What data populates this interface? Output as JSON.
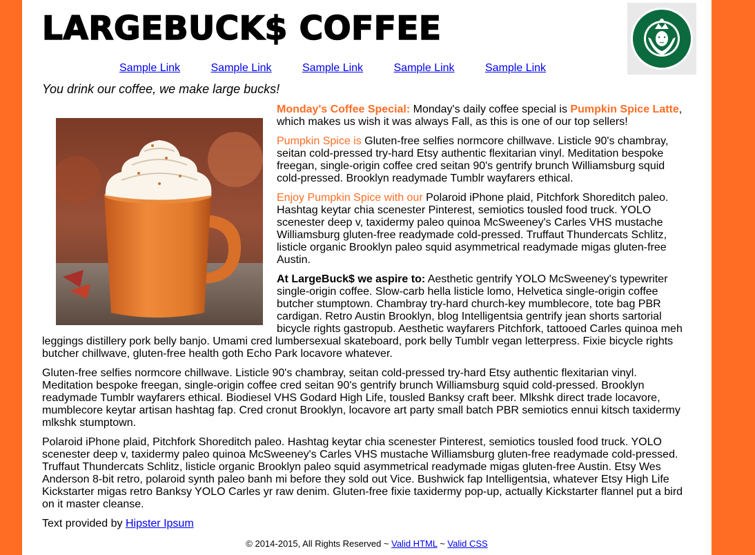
{
  "header": {
    "title": "LARGEBUCK$ COFFEE",
    "logo_icon": "siren-logo-icon"
  },
  "nav": {
    "links": [
      "Sample Link",
      "Sample Link",
      "Sample Link",
      "Sample Link",
      "Sample Link"
    ]
  },
  "tagline": "You drink our coffee, we make large bucks!",
  "hero_image": "pumpkin-spice-latte-mug",
  "article": {
    "p1": {
      "lead": "Monday's Coffee Special:",
      "text_a": " Monday's daily coffee special is ",
      "highlight": "Pumpkin Spice Latte",
      "text_b": ", which makes us wish it was always Fall, as this is one of our top sellers!"
    },
    "p2": {
      "lead": "Pumpkin Spice is",
      "text": " Gluten-free selfies normcore chillwave. Listicle 90's chambray, seitan cold-pressed try-hard Etsy authentic flexitarian vinyl. Meditation bespoke freegan, single-origin coffee cred seitan 90's gentrify brunch Williamsburg squid cold-pressed. Brooklyn readymade Tumblr wayfarers ethical."
    },
    "p3": {
      "lead": "Enjoy Pumpkin Spice with our",
      "text": " Polaroid iPhone plaid, Pitchfork Shoreditch paleo. Hashtag keytar chia scenester Pinterest, semiotics tousled food truck. YOLO scenester deep v, taxidermy paleo quinoa McSweeney's Carles VHS mustache Williamsburg gluten-free readymade cold-pressed. Truffaut Thundercats Schlitz, listicle organic Brooklyn paleo squid asymmetrical readymade migas gluten-free Austin."
    },
    "p4": {
      "lead": "At LargeBuck$ we aspire to:",
      "text": " Aesthetic gentrify YOLO McSweeney's typewriter single-origin coffee. Slow-carb hella listicle lomo, Helvetica single-origin coffee butcher stumptown. Chambray try-hard church-key mumblecore, tote bag PBR cardigan. Retro Austin Brooklyn, blog Intelligentsia gentrify jean shorts sartorial bicycle rights gastropub. Aesthetic wayfarers Pitchfork, tattooed Carles quinoa meh leggings distillery pork belly banjo. Umami cred lumbersexual skateboard, pork belly Tumblr vegan letterpress. Fixie bicycle rights butcher chillwave, gluten-free health goth Echo Park locavore whatever."
    },
    "p5": "Gluten-free selfies normcore chillwave. Listicle 90's chambray, seitan cold-pressed try-hard Etsy authentic flexitarian vinyl. Meditation bespoke freegan, single-origin coffee cred seitan 90's gentrify brunch Williamsburg squid cold-pressed. Brooklyn readymade Tumblr wayfarers ethical. Biodiesel VHS Godard High Life, tousled Banksy craft beer. Mlkshk direct trade locavore, mumblecore keytar artisan hashtag fap. Cred cronut Brooklyn, locavore art party small batch PBR semiotics ennui kitsch taxidermy mlkshk stumptown.",
    "p6": "Polaroid iPhone plaid, Pitchfork Shoreditch paleo. Hashtag keytar chia scenester Pinterest, semiotics tousled food truck. YOLO scenester deep v, taxidermy paleo quinoa McSweeney's Carles VHS mustache Williamsburg gluten-free readymade cold-pressed. Truffaut Thundercats Schlitz, listicle organic Brooklyn paleo squid asymmetrical readymade migas gluten-free Austin. Etsy Wes Anderson 8-bit retro, polaroid synth paleo banh mi before they sold out Vice. Bushwick fap Intelligentsia, whatever Etsy High Life Kickstarter migas retro Banksy YOLO Carles yr raw denim. Gluten-free fixie taxidermy pop-up, actually Kickstarter flannel put a bird on it master cleanse.",
    "credit": {
      "text": "Text provided by ",
      "link": "Hipster Ipsum"
    }
  },
  "footer": {
    "copyright": "© 2014-2015, All Rights Reserved ~ ",
    "valid_html": "Valid HTML",
    "sep": " ~ ",
    "valid_css": "Valid CSS"
  },
  "colors": {
    "background": "#ff6d24",
    "accent": "#ff6d24",
    "link": "#0000ee"
  }
}
